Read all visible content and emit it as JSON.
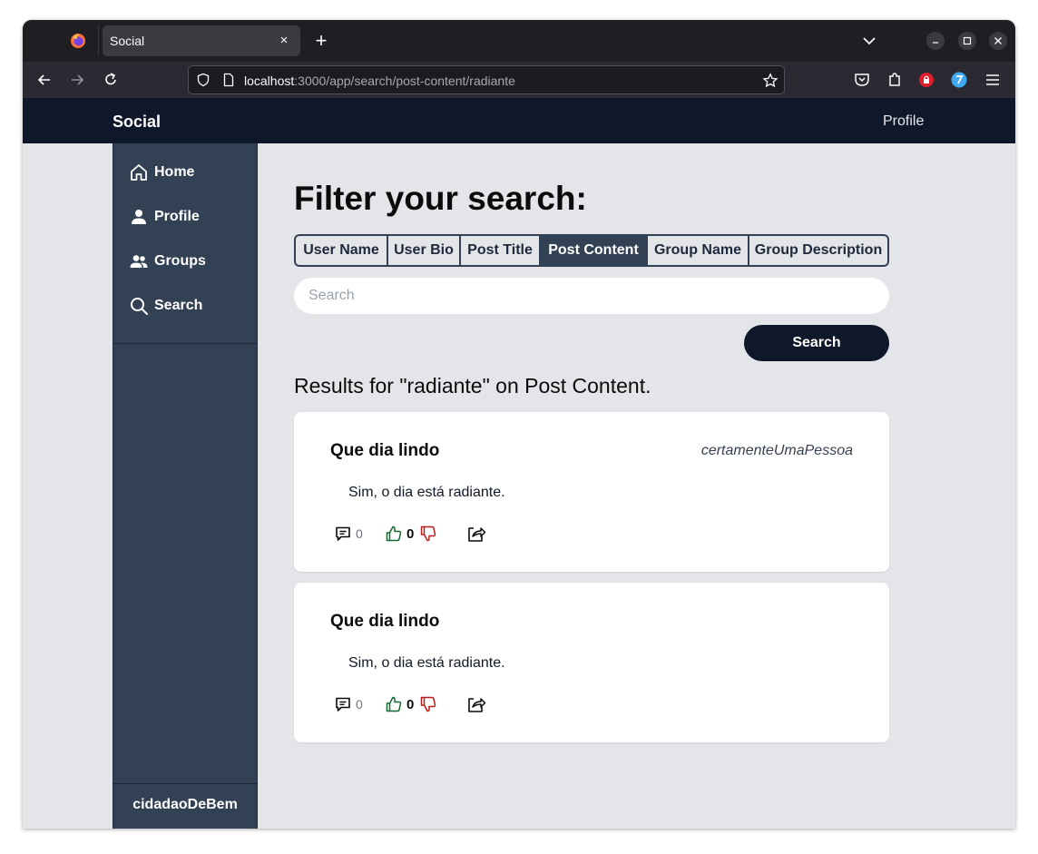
{
  "browser": {
    "tab_title": "Social",
    "tab_close": "×",
    "new_tab": "+",
    "url_host": "localhost",
    "url_rest": ":3000/app/search/post-content/radiante"
  },
  "app": {
    "brand": "Social",
    "header_profile": "Profile"
  },
  "sidebar": {
    "items": [
      {
        "label": "Home",
        "icon": "home-icon"
      },
      {
        "label": "Profile",
        "icon": "person-icon"
      },
      {
        "label": "Groups",
        "icon": "groups-icon"
      },
      {
        "label": "Search",
        "icon": "search-icon"
      }
    ],
    "username": "cidadaoDeBem"
  },
  "search": {
    "heading": "Filter your search:",
    "filters": [
      {
        "label": "User Name",
        "active": false
      },
      {
        "label": "User Bio",
        "active": false
      },
      {
        "label": "Post Title",
        "active": false
      },
      {
        "label": "Post Content",
        "active": true
      },
      {
        "label": "Group Name",
        "active": false
      },
      {
        "label": "Group Description",
        "active": false
      }
    ],
    "placeholder": "Search",
    "value": "",
    "button_label": "Search",
    "results_title": "Results for \"radiante\" on Post Content."
  },
  "posts": [
    {
      "title": "Que dia lindo",
      "author": "certamenteUmaPessoa",
      "body": "Sim, o dia está radiante.",
      "comments": "0",
      "votes": "0"
    },
    {
      "title": "Que dia lindo",
      "author": "",
      "body": "Sim, o dia está radiante.",
      "comments": "0",
      "votes": "0"
    }
  ],
  "colors": {
    "header_bg": "#0f172a",
    "sidebar_bg": "#334155",
    "page_bg": "#e4e5e9",
    "upvote": "#166534",
    "downvote": "#b91c1c"
  }
}
